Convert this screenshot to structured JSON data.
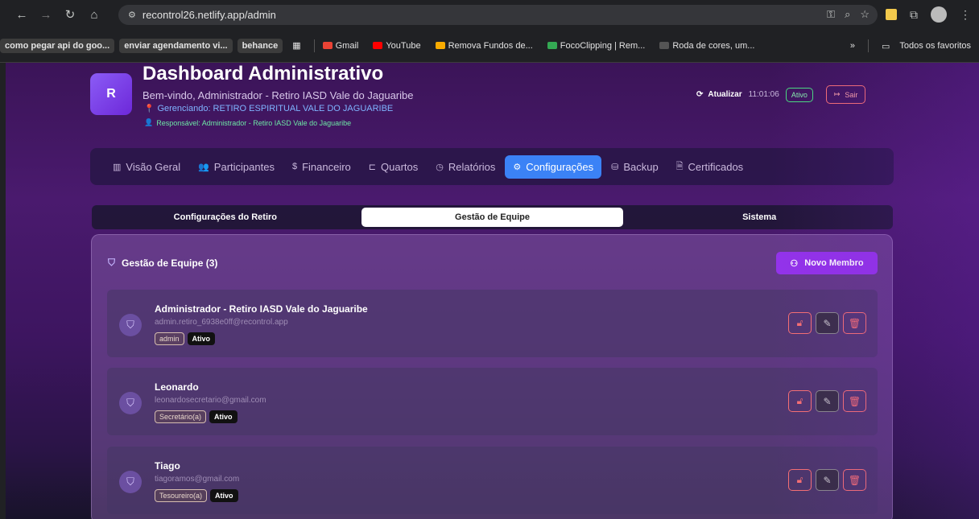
{
  "browser": {
    "url": "recontrol26.netlify.app/admin",
    "bookmarks": [
      {
        "label": "como pegar api do goo...",
        "pill": true
      },
      {
        "label": "enviar agendamento vi...",
        "pill": true
      },
      {
        "label": "behance",
        "pill": true
      },
      {
        "label": "Gmail",
        "pill": false,
        "color": "#ea4335"
      },
      {
        "label": "YouTube",
        "pill": false,
        "color": "#ff0000"
      },
      {
        "label": "Remova Fundos de...",
        "pill": false,
        "color": "#f9ab00"
      },
      {
        "label": "FocoClipping | Rem...",
        "pill": false,
        "color": "#34a853"
      },
      {
        "label": "Roda de cores, um...",
        "pill": false,
        "color": "#555555"
      }
    ],
    "more": "»",
    "all_bookmarks": "Todos os favoritos"
  },
  "header": {
    "logo_letter": "R",
    "title": "Dashboard Administrativo",
    "subtitle": "Bem-vindo, Administrador - Retiro IASD Vale do Jaguaribe",
    "managing": "Gerenciando: RETIRO ESPIRITUAL VALE DO JAGUARIBE",
    "responsible": "Responsável: Administrador - Retiro IASD Vale do Jaguaribe",
    "refresh_label": "Atualizar",
    "time": "11:01:06",
    "status": "Ativo",
    "logout_label": "Sair"
  },
  "tabs": [
    {
      "label": "Visão Geral",
      "icon": "bar-chart-icon"
    },
    {
      "label": "Participantes",
      "icon": "users-icon"
    },
    {
      "label": "Financeiro",
      "icon": "dollar-icon"
    },
    {
      "label": "Quartos",
      "icon": "bed-icon"
    },
    {
      "label": "Relatórios",
      "icon": "clock-icon"
    },
    {
      "label": "Configurações",
      "icon": "gear-icon",
      "active": true
    },
    {
      "label": "Backup",
      "icon": "database-icon"
    },
    {
      "label": "Certificados",
      "icon": "file-icon"
    }
  ],
  "subtabs": [
    {
      "label": "Configurações do Retiro"
    },
    {
      "label": "Gestão de Equipe",
      "active": true
    },
    {
      "label": "Sistema"
    }
  ],
  "team": {
    "title": "Gestão de Equipe (3)",
    "new_member_label": "Novo Membro",
    "members": [
      {
        "name": "Administrador - Retiro IASD Vale do Jaguaribe",
        "email": "admin.retiro_6938e0ff@recontrol.app",
        "role": "admin",
        "status": "Ativo"
      },
      {
        "name": "Leonardo",
        "email": "leonardosecretario@gmail.com",
        "role": "Secretário(a)",
        "status": "Ativo"
      },
      {
        "name": "Tiago",
        "email": "tiagoramos@gmail.com",
        "role": "Tesoureiro(a)",
        "status": "Ativo"
      }
    ]
  }
}
